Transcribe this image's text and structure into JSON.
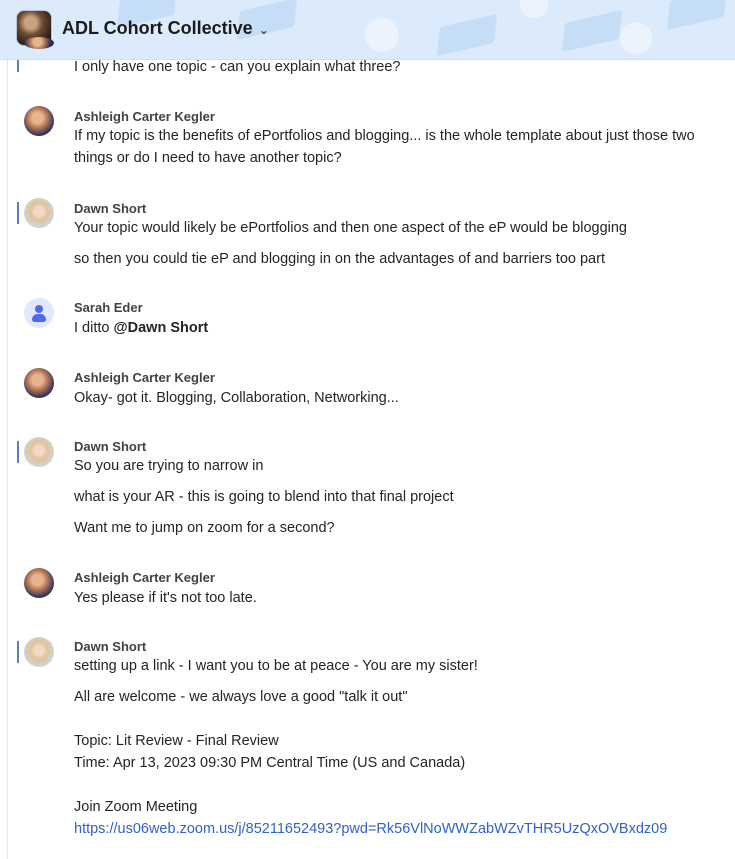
{
  "header": {
    "title": "ADL Cohort Collective",
    "dropdown_icon": "chevron-down-icon"
  },
  "messages": [
    {
      "author": "",
      "lines": [
        "I only have one topic - can you explain what three?"
      ]
    },
    {
      "author": "Ashleigh Carter Kegler",
      "lines": [
        "If my topic is the benefits of ePortfolios and blogging... is the whole template about just those two",
        "things or do I need to have another topic?"
      ]
    },
    {
      "author": "Dawn Short",
      "lines": [
        "Your topic would likely be ePortfolios and then one aspect of the eP would be blogging",
        "so then you could tie eP and blogging in on the advantages of and barriers too part"
      ]
    },
    {
      "author": "Sarah Eder",
      "lines": [
        "I ditto "
      ],
      "mention": "@Dawn Short"
    },
    {
      "author": "Ashleigh Carter Kegler",
      "lines": [
        "Okay- got it. Blogging, Collaboration, Networking..."
      ]
    },
    {
      "author": "Dawn Short",
      "lines": [
        "So you are trying to narrow in",
        "what is your AR - this is going to blend into that final project",
        "Want me to jump on zoom for a second?"
      ]
    },
    {
      "author": "Ashleigh Carter Kegler",
      "lines": [
        "Yes please if it's not too late."
      ]
    },
    {
      "author": "Dawn Short",
      "lines": [
        "setting up a link - I want you to be at peace - You are my sister!",
        "All are welcome - we always love a good \"talk it out\"",
        "Topic: Lit Review - Final Review",
        "Time: Apr 13, 2023 09:30 PM Central Time (US and Canada)",
        "Join Zoom Meeting"
      ],
      "link": "https://us06web.zoom.us/j/85211652493?pwd=Rk56VlNoWWZabWZvTHR5UzQxOVBxdz09"
    }
  ]
}
